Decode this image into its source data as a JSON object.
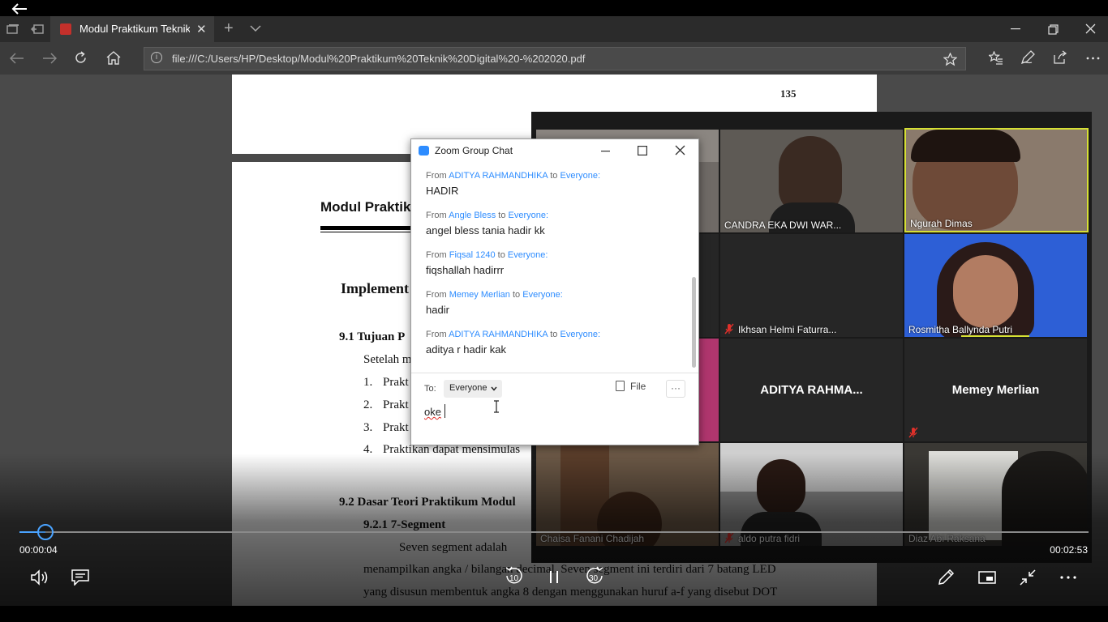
{
  "browser": {
    "tab_title": "Modul Praktikum Teknik",
    "url": "file:///C:/Users/HP/Desktop/Modul%20Praktikum%20Teknik%20Digital%20-%202020.pdf",
    "new_tab_glyph": "+",
    "close_glyph": "✕"
  },
  "pdf": {
    "page_number": "135",
    "header": "Modul Praktik",
    "implement": "Implement",
    "sec91": "9.1  Tujuan P",
    "setelah": "Setelah m",
    "list": [
      {
        "num": "1.",
        "text": "Prakt"
      },
      {
        "num": "2.",
        "text": "Prakt"
      },
      {
        "num": "3.",
        "text": "Prakt"
      },
      {
        "num": "4.",
        "text": "Praktikan dapat mensimulas"
      }
    ],
    "sec92": "9.2  Dasar Teori Praktikum Modul",
    "sub921": "9.2.1  7-Segment",
    "para_line1": "Seven   segment   adalah",
    "para_line2": "menampilkan angka / bilangan decimal. Seven segment ini terdiri dari 7 batang LED",
    "para_line3": "yang disusun membentuk angka 8 dengan menggunakan huruf a-f yang disebut DOT"
  },
  "gallery": {
    "tiles": [
      {
        "name": ""
      },
      {
        "name": "CANDRA EKA DWI WAR..."
      },
      {
        "name": "Ngurah Dimas"
      },
      {
        "name": ""
      },
      {
        "name": "Ikhsan Helmi Faturra..."
      },
      {
        "name": "Rosmitha Ballynda Putri"
      },
      {
        "name": ""
      },
      {
        "name": "ADITYA  RAHMA..."
      },
      {
        "name": "Memey Merlian"
      },
      {
        "name": "Chaisa Fanani Chadijah"
      },
      {
        "name": "aldo putra fidri"
      },
      {
        "name": "Diaz Abi Raksana"
      }
    ]
  },
  "chat": {
    "title": "Zoom Group Chat",
    "from_word": "From",
    "to_word": "to",
    "messages": [
      {
        "sender": "ADITYA RAHMANDHIKA",
        "recipient": "Everyone:",
        "text": "HADIR"
      },
      {
        "sender": "Angle Bless",
        "recipient": "Everyone:",
        "text": "angel bless tania hadir kk"
      },
      {
        "sender": "Fiqsal 1240",
        "recipient": "Everyone:",
        "text": "fiqshallah hadirrr"
      },
      {
        "sender": "Memey Merlian",
        "recipient": "Everyone:",
        "text": "hadir"
      },
      {
        "sender": "ADITYA RAHMANDHIKA",
        "recipient": "Everyone:",
        "text": "aditya r hadir kak"
      }
    ],
    "to_label": "To:",
    "to_value": "Everyone",
    "file_label": "File",
    "more_label": "···",
    "input_value": "oke"
  },
  "player": {
    "elapsed": "00:00:04",
    "remaining": "00:02:53",
    "progress_fraction": 0.024,
    "skip_back": "10",
    "skip_forward": "30"
  },
  "colors": {
    "accent_blue": "#2d8cff",
    "seek_blue": "#4aa3ff",
    "active_speaker": "#d6e034",
    "mute_red": "#e0302a"
  }
}
